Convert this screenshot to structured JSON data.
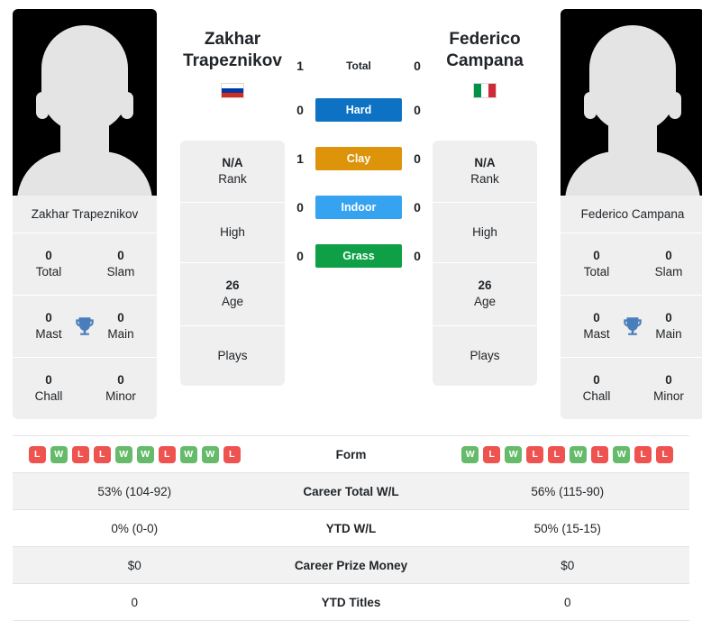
{
  "players": {
    "left": {
      "name": "Zakhar Trapeznikov",
      "name_line1": "Zakhar",
      "name_line2": "Trapeznikov",
      "flag": "flag-russia",
      "avatar": "player-photo-placeholder",
      "titles": {
        "total": "0",
        "total_label": "Total",
        "slam": "0",
        "slam_label": "Slam",
        "mast": "0",
        "mast_label": "Mast",
        "main": "0",
        "main_label": "Main",
        "chall": "0",
        "chall_label": "Chall",
        "minor": "0",
        "minor_label": "Minor"
      },
      "info": {
        "rank_value": "N/A",
        "rank_label": "Rank",
        "high_label": "High",
        "age_value": "26",
        "age_label": "Age",
        "plays_label": "Plays"
      },
      "form": [
        "L",
        "W",
        "L",
        "L",
        "W",
        "W",
        "L",
        "W",
        "W",
        "L"
      ],
      "career_total_wl": "53% (104-92)",
      "ytd_wl": "0% (0-0)",
      "career_prize_money": "$0",
      "ytd_titles": "0"
    },
    "right": {
      "name": "Federico Campana",
      "name_line1": "Federico",
      "name_line2": "Campana",
      "flag": "flag-italy",
      "avatar": "player-photo-placeholder",
      "titles": {
        "total": "0",
        "total_label": "Total",
        "slam": "0",
        "slam_label": "Slam",
        "mast": "0",
        "mast_label": "Mast",
        "main": "0",
        "main_label": "Main",
        "chall": "0",
        "chall_label": "Chall",
        "minor": "0",
        "minor_label": "Minor"
      },
      "info": {
        "rank_value": "N/A",
        "rank_label": "Rank",
        "high_label": "High",
        "age_value": "26",
        "age_label": "Age",
        "plays_label": "Plays"
      },
      "form": [
        "W",
        "L",
        "W",
        "L",
        "L",
        "W",
        "L",
        "W",
        "L",
        "L"
      ],
      "career_total_wl": "56% (115-90)",
      "ytd_wl": "50% (15-15)",
      "career_prize_money": "$0",
      "ytd_titles": "0"
    }
  },
  "head_to_head": {
    "rows": [
      {
        "label": "Total",
        "left": "1",
        "right": "0",
        "style": "plain",
        "color": ""
      },
      {
        "label": "Hard",
        "left": "0",
        "right": "0",
        "style": "badge",
        "color": "#0d72c4"
      },
      {
        "label": "Clay",
        "left": "1",
        "right": "0",
        "style": "badge",
        "color": "#dd940a"
      },
      {
        "label": "Indoor",
        "left": "0",
        "right": "0",
        "style": "badge",
        "color": "#35a3f0"
      },
      {
        "label": "Grass",
        "left": "0",
        "right": "0",
        "style": "badge",
        "color": "#0e9f47"
      }
    ]
  },
  "comparison": {
    "rows": [
      {
        "label": "Form",
        "type": "form"
      },
      {
        "label": "Career Total W/L",
        "type": "text",
        "key": "career_total_wl"
      },
      {
        "label": "YTD W/L",
        "type": "text",
        "key": "ytd_wl"
      },
      {
        "label": "Career Prize Money",
        "type": "text",
        "key": "career_prize_money"
      },
      {
        "label": "YTD Titles",
        "type": "text",
        "key": "ytd_titles"
      }
    ]
  },
  "colors": {
    "win": "#66bb6a",
    "loss": "#ef5350",
    "card_bg": "#efefef",
    "row_shaded": "#f2f2f2",
    "trophy": "#4a7ebb"
  }
}
